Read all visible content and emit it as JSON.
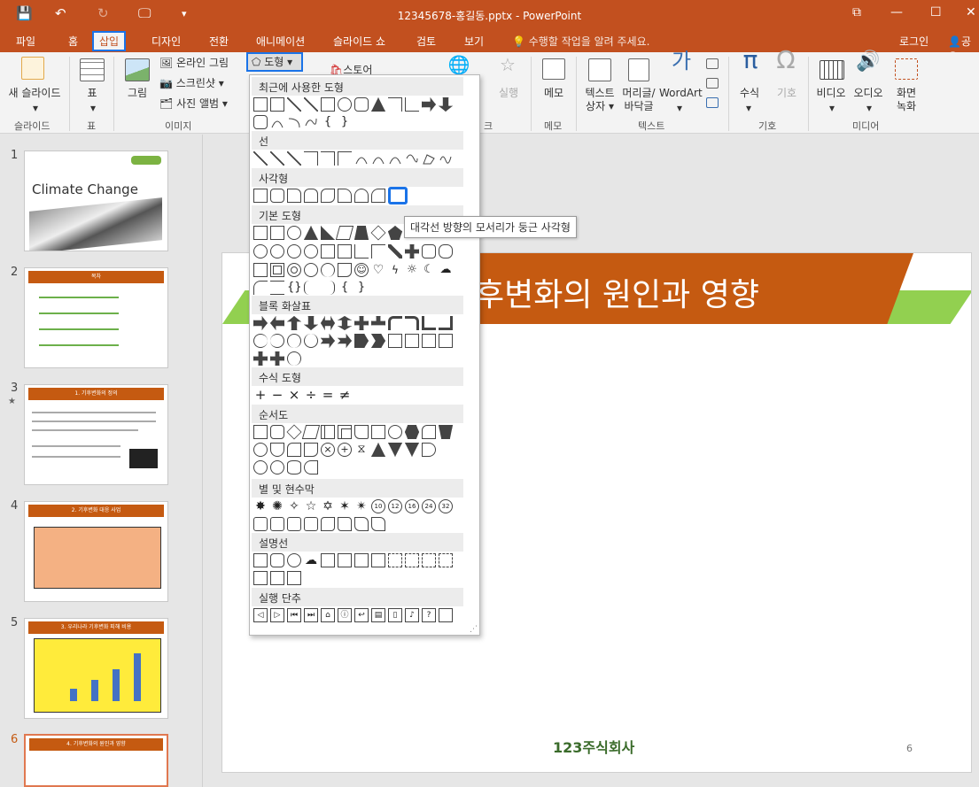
{
  "window": {
    "title": "12345678-홍길동.pptx - PowerPoint",
    "save_icon": "💾",
    "undo_icon": "↶",
    "redo_icon": "↻",
    "present_icon": "🖵",
    "more_icon": "▾",
    "restore_icon": "⧉",
    "minimize_icon": "—",
    "maximize_icon": "☐",
    "close_icon": "✕"
  },
  "menu": {
    "file": "파일",
    "home": "홈",
    "insert": "삽입",
    "design": "디자인",
    "transitions": "전환",
    "animations": "애니메이션",
    "slideshow": "슬라이드 쇼",
    "review": "검토",
    "view": "보기",
    "tell_me": "💡 수행할 작업을 알려 주세요.",
    "signin": "로그인",
    "share": "공유"
  },
  "ribbon": {
    "new_slide": "새 슬라이드",
    "table": "표",
    "picture": "그림",
    "online_picture": "온라인 그림",
    "screenshot": "스크린샷",
    "photo_album": "사진 앨범",
    "shapes": "도형",
    "store": "스토어",
    "action": "실행",
    "comment": "메모",
    "textbox_1": "텍스트",
    "textbox_2": "상자",
    "header_1": "머리글/",
    "header_2": "바닥글",
    "wordart": "WordArt",
    "equation": "수식",
    "symbol": "기호",
    "video": "비디오",
    "audio": "오디오",
    "screenrec_1": "화면",
    "screenrec_2": "녹화",
    "groups": {
      "slides": "슬라이드",
      "tables": "표",
      "images": "이미지",
      "links": "크",
      "comments": "메모",
      "text": "텍스트",
      "symbols": "기호",
      "media": "미디어"
    }
  },
  "shapes_menu": {
    "recent": "최근에 사용한 도형",
    "lines": "선",
    "rectangles": "사각형",
    "basic": "기본 도형",
    "block_arrows": "블록 화살표",
    "equation": "수식 도형",
    "flowchart": "순서도",
    "stars": "별 및 현수막",
    "callouts": "설명선",
    "action_buttons": "실행 단추",
    "tooltip": "대각선 방향의 모서리가 둥근 사각형"
  },
  "slides_panel": {
    "slide1_title": "Climate Change",
    "slide2_title": "목차",
    "slide3_title": "1. 기후변화의 정의",
    "slide4_title": "2. 기후변화 대응 사업",
    "slide5_title": "3. 우리나라 기후변화 피해 비용",
    "slide6_title": "4. 기후변화의 원인과 영향",
    "numbers": [
      "1",
      "2",
      "3",
      "4",
      "5",
      "6"
    ],
    "star": "★"
  },
  "slide": {
    "title": "후변화의 원인과 영향",
    "logo": "123주식회사",
    "page": "6"
  }
}
